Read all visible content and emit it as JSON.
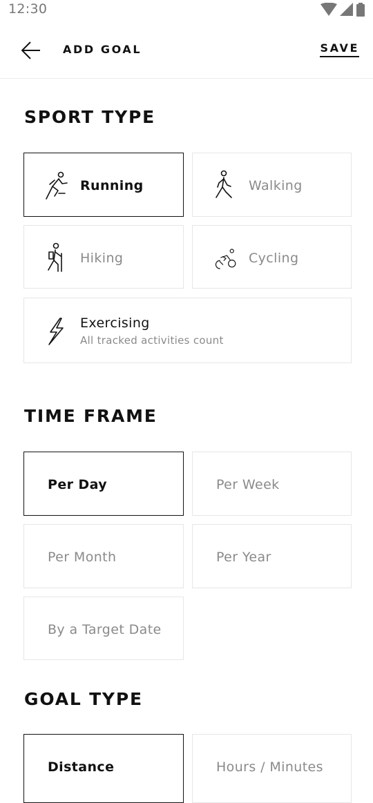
{
  "status_bar": {
    "time": "12:30"
  },
  "header": {
    "title": "ADD GOAL",
    "save_label": "SAVE"
  },
  "sport_type": {
    "title": "SPORT TYPE",
    "options": [
      {
        "label": "Running",
        "icon": "running-icon",
        "selected": true
      },
      {
        "label": "Walking",
        "icon": "walking-icon",
        "selected": false
      },
      {
        "label": "Hiking",
        "icon": "hiking-icon",
        "selected": false
      },
      {
        "label": "Cycling",
        "icon": "cycling-icon",
        "selected": false
      },
      {
        "label": "Exercising",
        "sublabel": "All tracked activities count",
        "icon": "lightning-icon",
        "selected": false
      }
    ]
  },
  "time_frame": {
    "title": "TIME FRAME",
    "options": [
      {
        "label": "Per Day",
        "selected": true
      },
      {
        "label": "Per Week",
        "selected": false
      },
      {
        "label": "Per Month",
        "selected": false
      },
      {
        "label": "Per Year",
        "selected": false
      },
      {
        "label": "By a Target Date",
        "selected": false
      }
    ]
  },
  "goal_type": {
    "title": "GOAL TYPE",
    "options": [
      {
        "label": "Distance",
        "selected": true
      },
      {
        "label": "Hours / Minutes",
        "selected": false
      }
    ]
  }
}
